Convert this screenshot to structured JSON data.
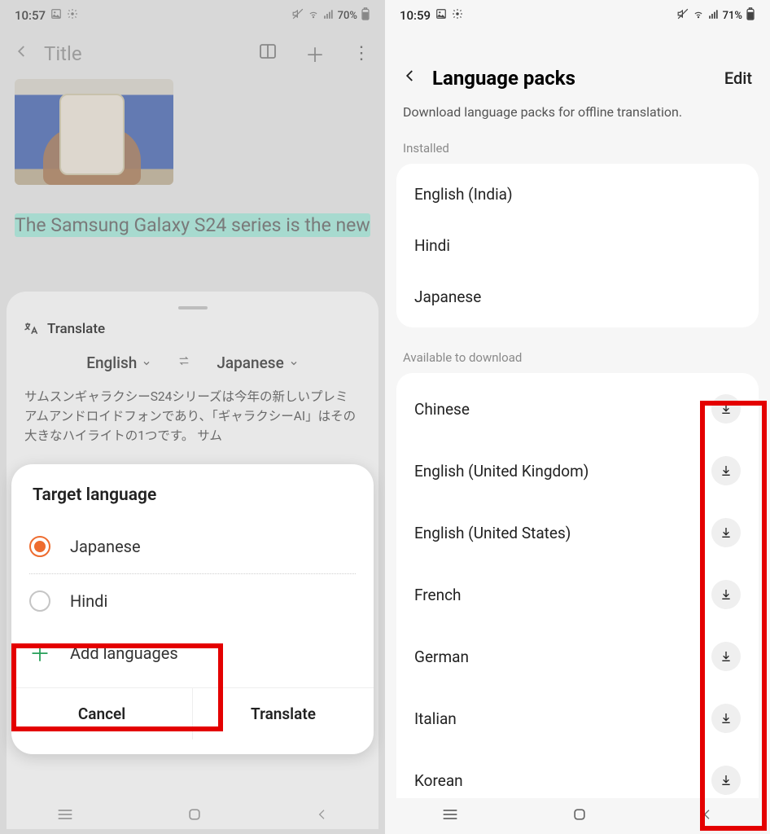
{
  "left": {
    "status": {
      "time": "10:57",
      "battery": "70%"
    },
    "header": {
      "title": "Title"
    },
    "sentence": "The Samsung Galaxy S24 series is the new",
    "translate": {
      "label": "Translate",
      "from": "English",
      "to": "Japanese",
      "text": "サムスンギャラクシーS24シリーズは今年の新しいプレミアムアンドロイドフォンであり、「ギャラクシーAI」はその大きなハイライトの1つです。 サム"
    },
    "modal": {
      "title": "Target language",
      "options": [
        "Japanese",
        "Hindi"
      ],
      "add": "Add languages",
      "cancel": "Cancel",
      "confirm": "Translate"
    }
  },
  "right": {
    "status": {
      "time": "10:59",
      "battery": "71%"
    },
    "header": {
      "title": "Language packs",
      "edit": "Edit"
    },
    "description": "Download language packs for offline translation.",
    "installed_label": "Installed",
    "installed": [
      "English (India)",
      "Hindi",
      "Japanese"
    ],
    "available_label": "Available to download",
    "available": [
      "Chinese",
      "English (United Kingdom)",
      "English (United States)",
      "French",
      "German",
      "Italian",
      "Korean"
    ]
  }
}
